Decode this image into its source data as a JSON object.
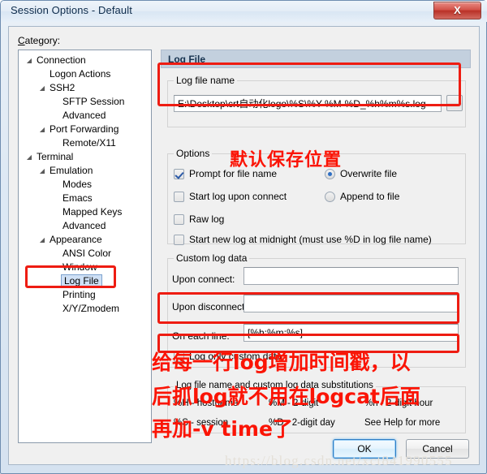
{
  "window": {
    "title": "Session Options - Default",
    "close_label": "X"
  },
  "category": {
    "label": "Category:",
    "tree": [
      {
        "label": "Connection",
        "indent": 0,
        "arrow": "◢",
        "selected": false
      },
      {
        "label": "Logon Actions",
        "indent": 1,
        "arrow": "",
        "selected": false
      },
      {
        "label": "SSH2",
        "indent": 1,
        "arrow": "◢",
        "selected": false
      },
      {
        "label": "SFTP Session",
        "indent": 2,
        "arrow": "",
        "selected": false
      },
      {
        "label": "Advanced",
        "indent": 2,
        "arrow": "",
        "selected": false
      },
      {
        "label": "Port Forwarding",
        "indent": 1,
        "arrow": "◢",
        "selected": false
      },
      {
        "label": "Remote/X11",
        "indent": 2,
        "arrow": "",
        "selected": false
      },
      {
        "label": "Terminal",
        "indent": 0,
        "arrow": "◢",
        "selected": false
      },
      {
        "label": "Emulation",
        "indent": 1,
        "arrow": "◢",
        "selected": false
      },
      {
        "label": "Modes",
        "indent": 2,
        "arrow": "",
        "selected": false
      },
      {
        "label": "Emacs",
        "indent": 2,
        "arrow": "",
        "selected": false
      },
      {
        "label": "Mapped Keys",
        "indent": 2,
        "arrow": "",
        "selected": false
      },
      {
        "label": "Advanced",
        "indent": 2,
        "arrow": "",
        "selected": false
      },
      {
        "label": "Appearance",
        "indent": 1,
        "arrow": "◢",
        "selected": false
      },
      {
        "label": "ANSI Color",
        "indent": 2,
        "arrow": "",
        "selected": false
      },
      {
        "label": "Window",
        "indent": 2,
        "arrow": "",
        "selected": false
      },
      {
        "label": "Log File",
        "indent": 2,
        "arrow": "",
        "selected": true
      },
      {
        "label": "Printing",
        "indent": 2,
        "arrow": "",
        "selected": false
      },
      {
        "label": "X/Y/Zmodem",
        "indent": 2,
        "arrow": "",
        "selected": false
      }
    ]
  },
  "panel": {
    "header": "Log File",
    "log_file_name": {
      "legend": "Log file name",
      "value": "E:\\Desktop\\crt自动化logo\\%S\\%Y-%M-%D_%h%m%s.log",
      "browse_label": "..."
    },
    "options": {
      "legend": "Options",
      "checkboxes": [
        {
          "label": "Prompt for file name",
          "checked": true
        },
        {
          "label": "Start log upon connect",
          "checked": false
        },
        {
          "label": "Raw log",
          "checked": false
        },
        {
          "label": "Start new log at midnight (must use %D in log file name)",
          "checked": false
        }
      ],
      "radios": [
        {
          "label": "Overwrite file",
          "selected": true
        },
        {
          "label": "Append to file",
          "selected": false
        }
      ]
    },
    "custom_log_data": {
      "legend": "Custom log data",
      "fields": [
        {
          "label": "Upon connect:",
          "value": ""
        },
        {
          "label": "Upon disconnect:",
          "value": ""
        },
        {
          "label": "On each line:",
          "value": "[%h:%m:%s]"
        }
      ],
      "log_only_custom": {
        "label": "Log only custom data",
        "checked": false
      }
    },
    "substitutions": {
      "legend": "Log file name and custom log data substitutions",
      "entries": [
        "%H - hostname",
        "%M - 2-digit",
        "%h - 2-digit hour",
        "%S - session",
        "%D - 2-digit day",
        "See Help for more"
      ]
    }
  },
  "footer": {
    "ok_label": "OK",
    "cancel_label": "Cancel"
  },
  "annotations": {
    "save_location": "默认保存位置",
    "bottom_line_1": "给每一行log增加时间戳，以",
    "bottom_line_2": "后抓log就不用在logcat后面",
    "bottom_line_3": "再加-v time了",
    "red_color": "#ee1c12"
  },
  "watermark": "https://blog.csdn.net/xct841990555"
}
